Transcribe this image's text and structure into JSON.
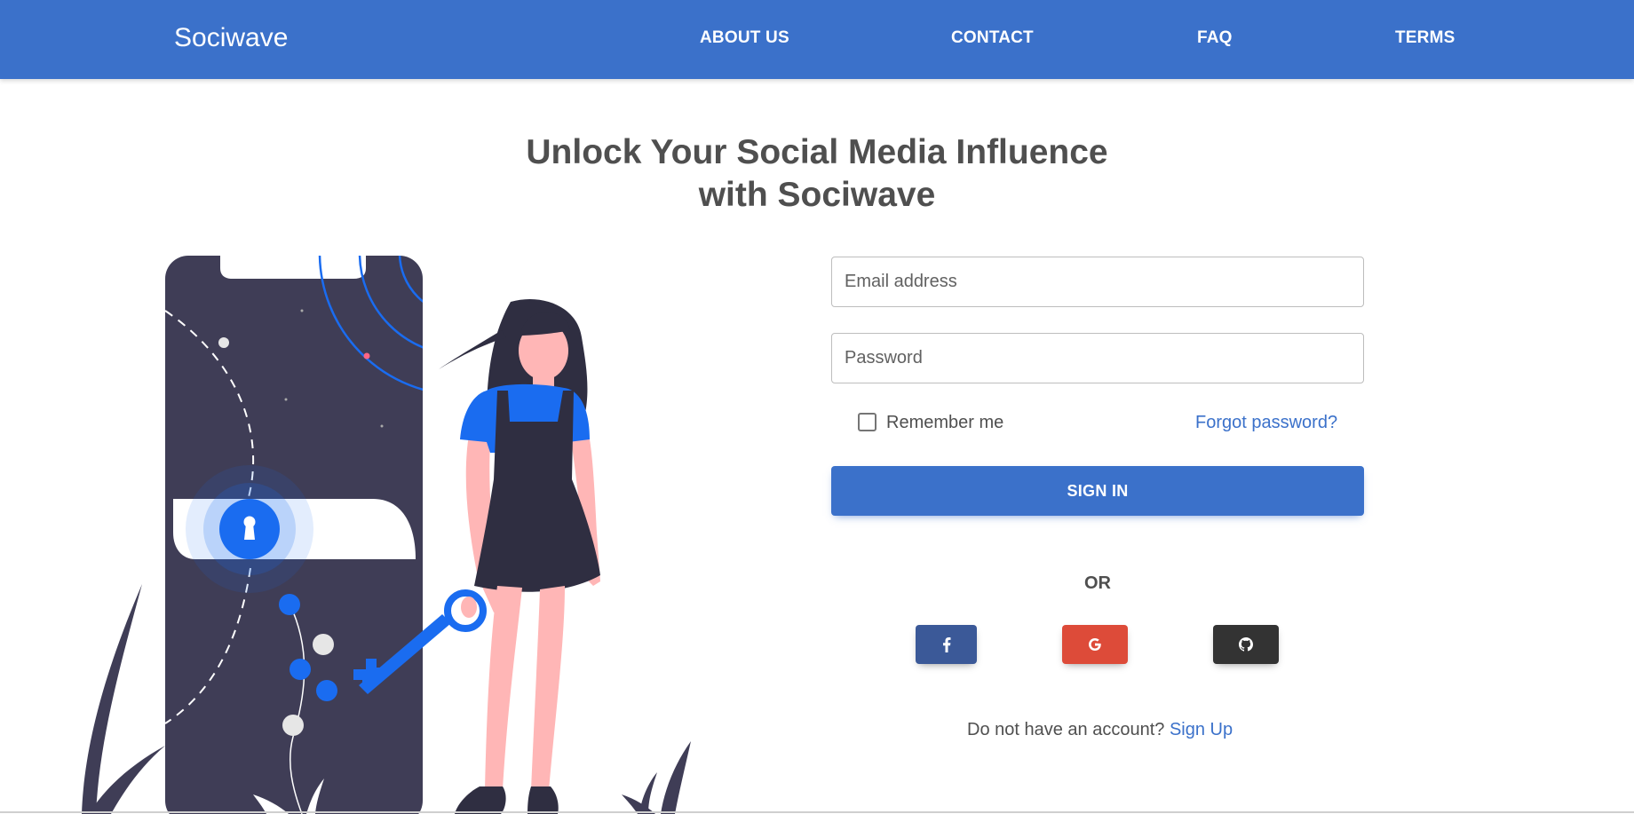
{
  "navbar": {
    "brand": "Sociwave",
    "links": [
      "ABOUT US",
      "CONTACT",
      "FAQ",
      "TERMS"
    ]
  },
  "hero": {
    "line1": "Unlock Your Social Media Influence",
    "line2": "with Sociwave"
  },
  "login_form": {
    "email": {
      "placeholder": "Email address",
      "value": ""
    },
    "password": {
      "placeholder": "Password",
      "value": ""
    },
    "remember_label": "Remember me",
    "remember_checked": false,
    "forgot_label": "Forgot password?",
    "signin_label": "SIGN IN",
    "or_label": "OR",
    "signup_prompt": "Do not have an account?",
    "signup_link": "Sign Up"
  },
  "social_buttons": [
    {
      "name": "facebook",
      "icon": "facebook-icon",
      "color": "#3b5998"
    },
    {
      "name": "google",
      "icon": "google-icon",
      "color": "#dd4b39"
    },
    {
      "name": "github",
      "icon": "github-icon",
      "color": "#333333"
    }
  ],
  "colors": {
    "primary": "#3b71ca",
    "illustration_dark": "#3f3d56",
    "illustration_accent": "#1a6cf0",
    "skin": "#ffb6b6"
  }
}
